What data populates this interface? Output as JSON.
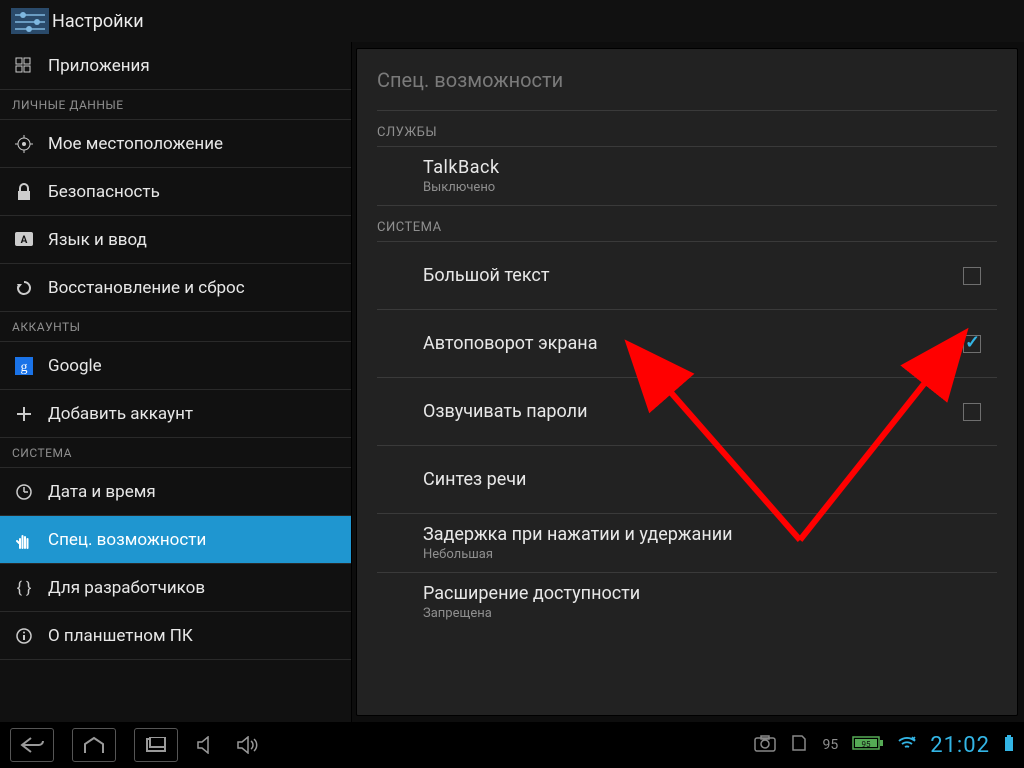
{
  "header": {
    "title": "Настройки"
  },
  "sidebar": {
    "headers": {
      "personal": "ЛИЧНЫЕ ДАННЫЕ",
      "accounts": "АККАУНТЫ",
      "system": "СИСТЕМА"
    },
    "items": {
      "apps": "Приложения",
      "location": "Мое местоположение",
      "security": "Безопасность",
      "language": "Язык и ввод",
      "backup": "Восстановление и сброс",
      "google": "Google",
      "addaccount": "Добавить аккаунт",
      "datetime": "Дата и время",
      "accessibility": "Спец. возможности",
      "developer": "Для разработчиков",
      "about": "О планшетном ПК"
    }
  },
  "detail": {
    "title": "Спец. возможности",
    "section_services": "СЛУЖБЫ",
    "section_system": "СИСТЕМА",
    "talkback": {
      "title": "TalkBack",
      "status": "Выключено"
    },
    "large_text": "Большой текст",
    "autorotate": "Автоповорот экрана",
    "speak_passwords": "Озвучивать пароли",
    "tts": "Синтез речи",
    "touch_delay": {
      "title": "Задержка при нажатии и удержании",
      "value": "Небольшая"
    },
    "a11y_ext": {
      "title": "Расширение доступности",
      "value": "Запрещена"
    }
  },
  "checkboxes": {
    "large_text": false,
    "autorotate": true,
    "speak_passwords": false
  },
  "navbar": {
    "battery_percent": "95",
    "battery_inner": "95",
    "clock": "21:02"
  }
}
